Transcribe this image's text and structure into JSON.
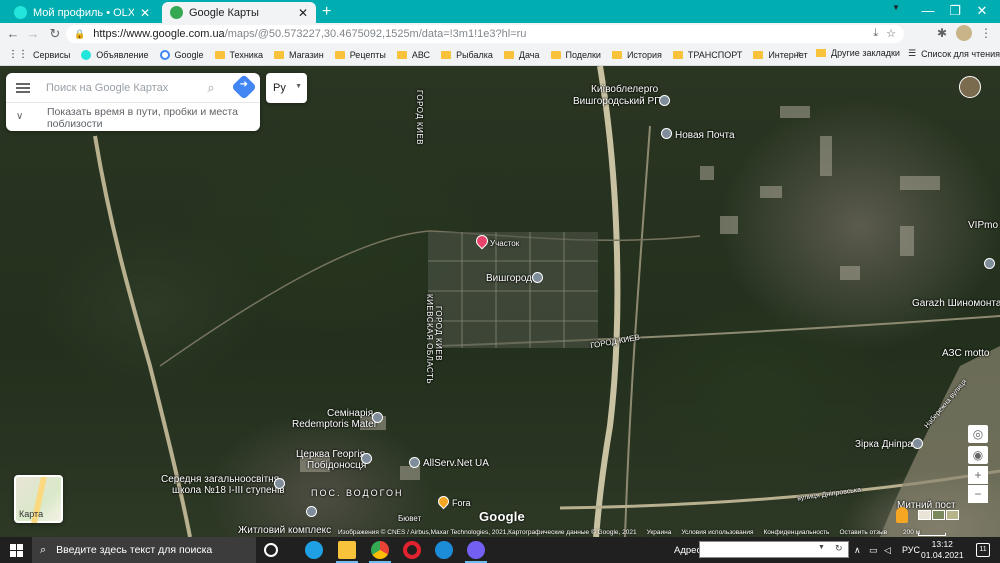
{
  "browser": {
    "tabs": [
      {
        "title": "Мой профиль • OLX.ua",
        "favicon": "olx-icon",
        "favicon_color": "#23e5db",
        "active": false
      },
      {
        "title": "Google Карты",
        "favicon": "maps-icon",
        "favicon_color": "#34a853",
        "active": true
      }
    ],
    "new_tab_symbol": "+",
    "tab_close_symbol": "✕",
    "window_controls": {
      "menu": "▼",
      "minimize": "—",
      "maximize": "❐",
      "close": "✕"
    },
    "nav": {
      "back": "←",
      "forward": "→",
      "reload": "↻"
    },
    "url_host": "https://www.google.com.ua",
    "url_path": "/maps/@50.573227,30.4675092,1525m/data=!3m1!1e3?hl=ru"
  },
  "bookmarks": {
    "items": [
      {
        "label": "Сервисы",
        "icon": "apps-grid-icon"
      },
      {
        "label": "Объявление",
        "icon": "olx-icon"
      },
      {
        "label": "Google",
        "icon": "google-icon"
      },
      {
        "label": "Техника",
        "icon": "folder-icon"
      },
      {
        "label": "Магазин",
        "icon": "folder-icon"
      },
      {
        "label": "Рецепты",
        "icon": "folder-icon"
      },
      {
        "label": "АВС",
        "icon": "folder-icon"
      },
      {
        "label": "Рыбалка",
        "icon": "folder-icon"
      },
      {
        "label": "Дача",
        "icon": "folder-icon"
      },
      {
        "label": "Поделки",
        "icon": "folder-icon"
      },
      {
        "label": "История",
        "icon": "folder-icon"
      },
      {
        "label": "ТРАНСПОРТ",
        "icon": "folder-icon"
      },
      {
        "label": "Интернет",
        "icon": "folder-icon"
      }
    ],
    "overflow": "»",
    "other": "Другие закладки",
    "reading_list": "Список для чтения"
  },
  "maps": {
    "search_placeholder": "Поиск на Google Картах",
    "commute_text": "Показать время в пути, пробки и места поблизости",
    "language": "Ру",
    "minimap_label": "Карта",
    "logo": "Google",
    "footer": [
      "Изображения © CNES / Airbus,Maxar Technologies, 2021,Картографические данные © Google, 2021",
      "Украина",
      "Условия использования",
      "Конфиденциальность",
      "Оставить отзыв"
    ],
    "scale": "200 м",
    "labels": [
      {
        "text": "Київоблелерго",
        "name": "label-kyivoblenergo"
      },
      {
        "text": "Вишгородський РП",
        "name": "label-vyshgorod-rp"
      },
      {
        "text": "Новая Почта",
        "name": "label-nova-poshta"
      },
      {
        "text": "Участок",
        "name": "label-uchastok"
      },
      {
        "text": "Вишгород",
        "name": "label-vyshgorod"
      },
      {
        "text": "VIPmo",
        "name": "label-vipmo"
      },
      {
        "text": "Garazh Шиномонтаж",
        "name": "label-garazh"
      },
      {
        "text": "АЗС motto",
        "name": "label-azs"
      },
      {
        "text": "Семінарія",
        "name": "label-seminary"
      },
      {
        "text": "Redemptoris Mater",
        "name": "label-redemptoris"
      },
      {
        "text": "Церква Георгія",
        "name": "label-church"
      },
      {
        "text": "Побідоносця",
        "name": "label-church-2"
      },
      {
        "text": "AllServ.Net UA",
        "name": "label-allserv"
      },
      {
        "text": "Середня загальноосвітня",
        "name": "label-school"
      },
      {
        "text": "школа №18 І-ІІІ ступенів",
        "name": "label-school-2"
      },
      {
        "text": "ПОС. ВОДОГОН",
        "name": "label-vodogon"
      },
      {
        "text": "Fora",
        "name": "label-fora"
      },
      {
        "text": "Бювет",
        "name": "label-byuvet"
      },
      {
        "text": "Житловий комплекс",
        "name": "label-residential"
      },
      {
        "text": "Зірка Дніпра",
        "name": "label-zirka"
      },
      {
        "text": "ГОРОД КИЕВ",
        "name": "label-road-city-kiev"
      },
      {
        "text": "вулиця Дніпровська",
        "name": "label-dniprovska"
      },
      {
        "text": "Набережна вулиця",
        "name": "label-naberezhna"
      },
      {
        "text": "Митний пост",
        "name": "label-customs"
      }
    ],
    "vertical_labels": [
      {
        "text": "ГОРОД КИЕВ",
        "name": "label-road-vertical-1"
      },
      {
        "text": "КИЕВСКАЯ ОБЛАСТЬ",
        "name": "label-region-kyiv"
      },
      {
        "text": "ГОРОД КИЕВ",
        "name": "label-road-vertical-2"
      }
    ],
    "marker_color": "#e8436a",
    "controls": {
      "globe": "◎",
      "locate": "◉",
      "zoom_in": "+",
      "zoom_out": "−"
    }
  },
  "taskbar": {
    "search_placeholder": "Введите здесь текст для поиска",
    "address_label": "Адрес",
    "language": "РУС",
    "time": "13:12",
    "date": "01.04.2021",
    "notifications": "11",
    "apps": [
      {
        "name": "cortana-icon",
        "color": "#ffffff"
      },
      {
        "name": "edge-icon",
        "color": "#1fa0e4"
      },
      {
        "name": "file-explorer-icon",
        "color": "#f8c23a"
      },
      {
        "name": "chrome-icon",
        "color": "#34a853"
      },
      {
        "name": "opera-icon",
        "color": "#e0232e"
      },
      {
        "name": "internet-explorer-icon",
        "color": "#1c8cd8"
      },
      {
        "name": "viber-icon",
        "color": "#7360f2"
      }
    ]
  }
}
